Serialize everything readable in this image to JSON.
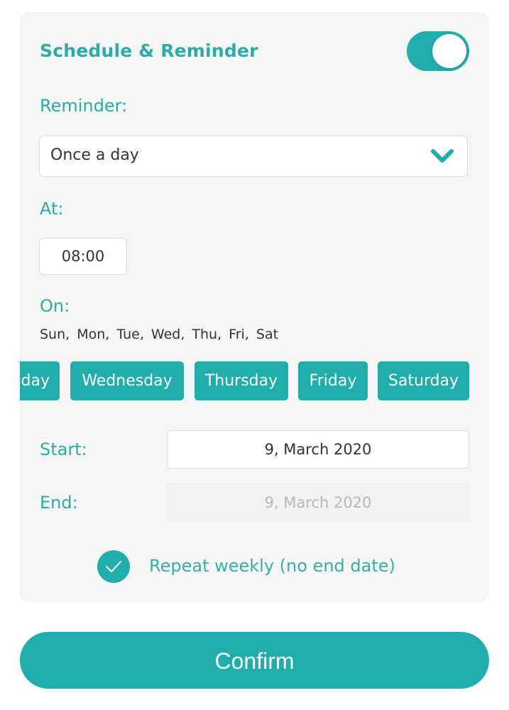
{
  "header": {
    "title": "Schedule & Reminder",
    "toggle_on": true
  },
  "reminder": {
    "label": "Reminder:",
    "selected": "Once a day",
    "icon": "chevron-down-icon"
  },
  "at": {
    "label": "At:",
    "time": "08:00"
  },
  "on": {
    "label": "On:",
    "summary": "Sun,  Mon,  Tue,  Wed,  Thu,  Fri,  Sat",
    "chips": [
      {
        "label": "Tuesday"
      },
      {
        "label": "Wednesday"
      },
      {
        "label": "Thursday"
      },
      {
        "label": "Friday"
      },
      {
        "label": "Saturday"
      }
    ]
  },
  "dates": {
    "start_label": "Start:",
    "start_value": "9, March 2020",
    "end_label": "End:",
    "end_value": "9, March 2020"
  },
  "repeat": {
    "label": "Repeat weekly (no end date)",
    "checked": true
  },
  "confirm_label": "Confirm",
  "colors": {
    "accent": "#20aeac",
    "card_bg": "#f5f5f5"
  }
}
